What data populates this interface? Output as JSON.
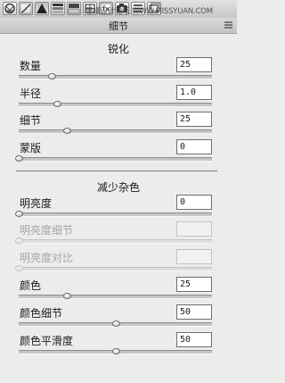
{
  "toolbar": {
    "tools": [
      {
        "icon": "aperture-icon",
        "active": false
      },
      {
        "icon": "tone-curve-icon",
        "active": false
      },
      {
        "icon": "detail-triangle-icon",
        "active": true
      },
      {
        "icon": "hsl-icon",
        "active": false
      },
      {
        "icon": "split-toning-icon",
        "active": false
      },
      {
        "icon": "lens-corrections-icon",
        "active": false
      },
      {
        "icon": "effects-icon",
        "active": false
      },
      {
        "icon": "camera-calibration-icon",
        "active": false
      },
      {
        "icon": "presets-icon",
        "active": false
      },
      {
        "icon": "snapshots-icon",
        "active": false
      }
    ],
    "watermark": "思缘设计论坛 WWW.MISSYUAN.COM"
  },
  "panel": {
    "title": "细节"
  },
  "sharpening": {
    "title": "锐化",
    "rows": [
      {
        "label": "数量",
        "value": "25",
        "level": 0.17,
        "disabled": false
      },
      {
        "label": "半径",
        "value": "1.0",
        "level": 0.2,
        "disabled": false
      },
      {
        "label": "细节",
        "value": "25",
        "level": 0.25,
        "disabled": false
      },
      {
        "label": "蒙版",
        "value": "0",
        "level": 0.0,
        "disabled": false
      }
    ]
  },
  "noise_reduction": {
    "title": "减少杂色",
    "rows": [
      {
        "label": "明亮度",
        "value": "0",
        "level": 0.0,
        "disabled": false
      },
      {
        "label": "明亮度细节",
        "value": "",
        "level": 0.0,
        "disabled": true
      },
      {
        "label": "明亮度对比",
        "value": "",
        "level": 0.0,
        "disabled": true
      },
      {
        "label": "颜色",
        "value": "25",
        "level": 0.25,
        "disabled": false
      },
      {
        "label": "颜色细节",
        "value": "50",
        "level": 0.5,
        "disabled": false
      },
      {
        "label": "颜色平滑度",
        "value": "50",
        "level": 0.5,
        "disabled": false
      }
    ]
  }
}
